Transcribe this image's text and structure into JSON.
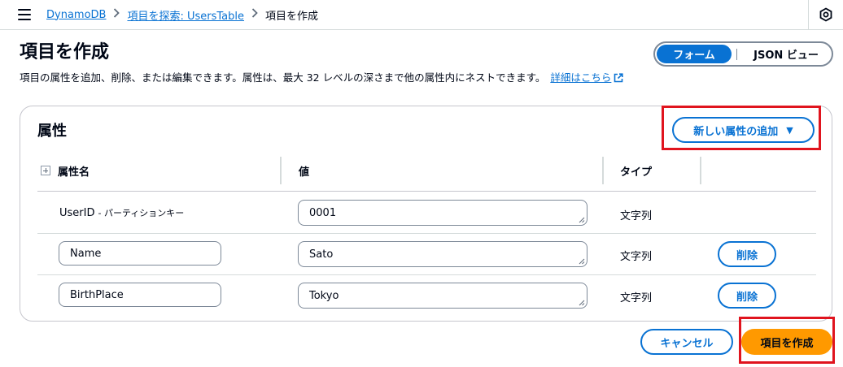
{
  "breadcrumbs": {
    "items": [
      {
        "label": "DynamoDB"
      },
      {
        "label": "項目を探索: UsersTable"
      }
    ],
    "current": "項目を作成"
  },
  "header": {
    "title": "項目を作成",
    "description": "項目の属性を追加、削除、または編集できます。属性は、最大 32 レベルの深さまで他の属性内にネストできます。",
    "learn_more": "詳細はこちら"
  },
  "view_toggle": {
    "form_label": "フォーム",
    "json_label": "JSON ビュー",
    "selected": "フォーム"
  },
  "attributes": {
    "title": "属性",
    "add_button": "新しい属性の追加",
    "columns": {
      "name": "属性名",
      "value": "値",
      "type": "タイプ"
    },
    "rows": [
      {
        "name": "UserID",
        "key_label": "- パーティションキー",
        "value": "0001",
        "type": "文字列"
      },
      {
        "name": "Name",
        "value": "Sato",
        "type": "文字列",
        "delete_label": "削除"
      },
      {
        "name": "BirthPlace",
        "value": "Tokyo",
        "type": "文字列",
        "delete_label": "削除"
      }
    ]
  },
  "footer": {
    "cancel": "キャンセル",
    "create": "項目を作成"
  },
  "colors": {
    "link": "#0972d3",
    "primary": "#ff9900",
    "highlight": "#e0141e"
  }
}
